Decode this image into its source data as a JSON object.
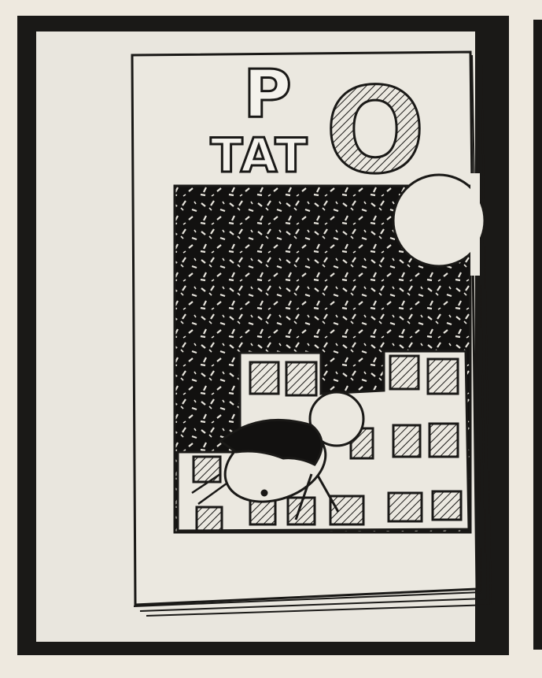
{
  "cover": {
    "title_top": "P",
    "title_bottom": "TAT",
    "title_big_letter": "O"
  },
  "colors": {
    "paper": "#eee9df",
    "ink": "#1a1917",
    "inner_paper": "#e9e6de"
  },
  "icons": [
    "moon-icon",
    "potato-character-icon",
    "building-window-icon"
  ]
}
